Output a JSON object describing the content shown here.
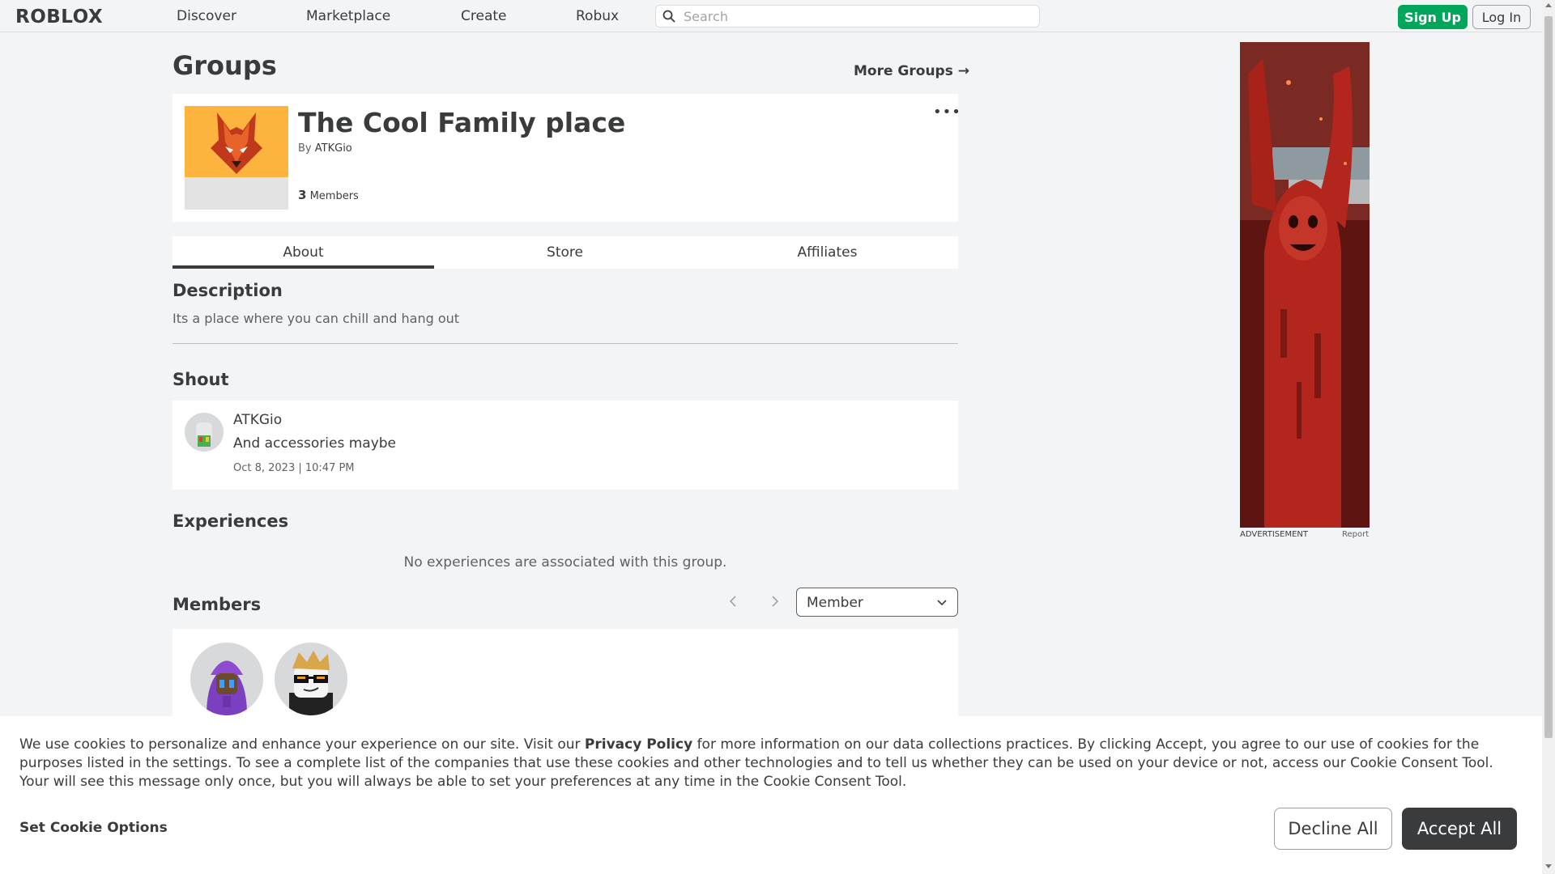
{
  "nav": {
    "logo": "ROBLOX",
    "links": [
      "Discover",
      "Marketplace",
      "Create",
      "Robux"
    ],
    "search_placeholder": "Search",
    "signup_label": "Sign Up",
    "login_label": "Log In"
  },
  "page": {
    "title": "Groups",
    "more_groups": "More Groups →"
  },
  "group": {
    "name": "The Cool Family place",
    "owner_prefix": "By",
    "owner": "ATKGio",
    "member_count": "3",
    "member_count_label": "Members",
    "more_menu": "•••"
  },
  "tabs": [
    "About",
    "Store",
    "Affiliates"
  ],
  "active_tab": "About",
  "description": {
    "title": "Description",
    "text": "Its a place where you can chill and hang out"
  },
  "shout": {
    "title": "Shout",
    "user": "ATKGio",
    "text": "And accessories maybe",
    "date": "Oct 8, 2023 | 10:47 PM"
  },
  "experiences": {
    "title": "Experiences",
    "empty_text": "No experiences are associated with this group."
  },
  "members": {
    "title": "Members",
    "role_selected": "Member"
  },
  "ad": {
    "label": "ADVERTISEMENT",
    "report": "Report"
  },
  "cookie": {
    "text_before": "We use cookies to personalize and enhance your experience on our site. Visit our ",
    "privacy_link": "Privacy Policy",
    "text_after": " for more information on our data collections practices. By clicking Accept, you agree to our use of cookies for the purposes listed in the settings. To see a complete list of the companies that use these cookies and other technologies and to tell us whether they can be used on your device or not, access our Cookie Consent Tool. Your will see this message only once, but you will always be able to set your preferences at any time in the Cookie Consent Tool.",
    "set_options": "Set Cookie Options",
    "decline": "Decline All",
    "accept": "Accept All"
  },
  "colors": {
    "signup_green": "#00a65a",
    "emblem_orange": "#fdb43e",
    "accept_dark": "#393b3d",
    "background": "#f2f4f5"
  }
}
